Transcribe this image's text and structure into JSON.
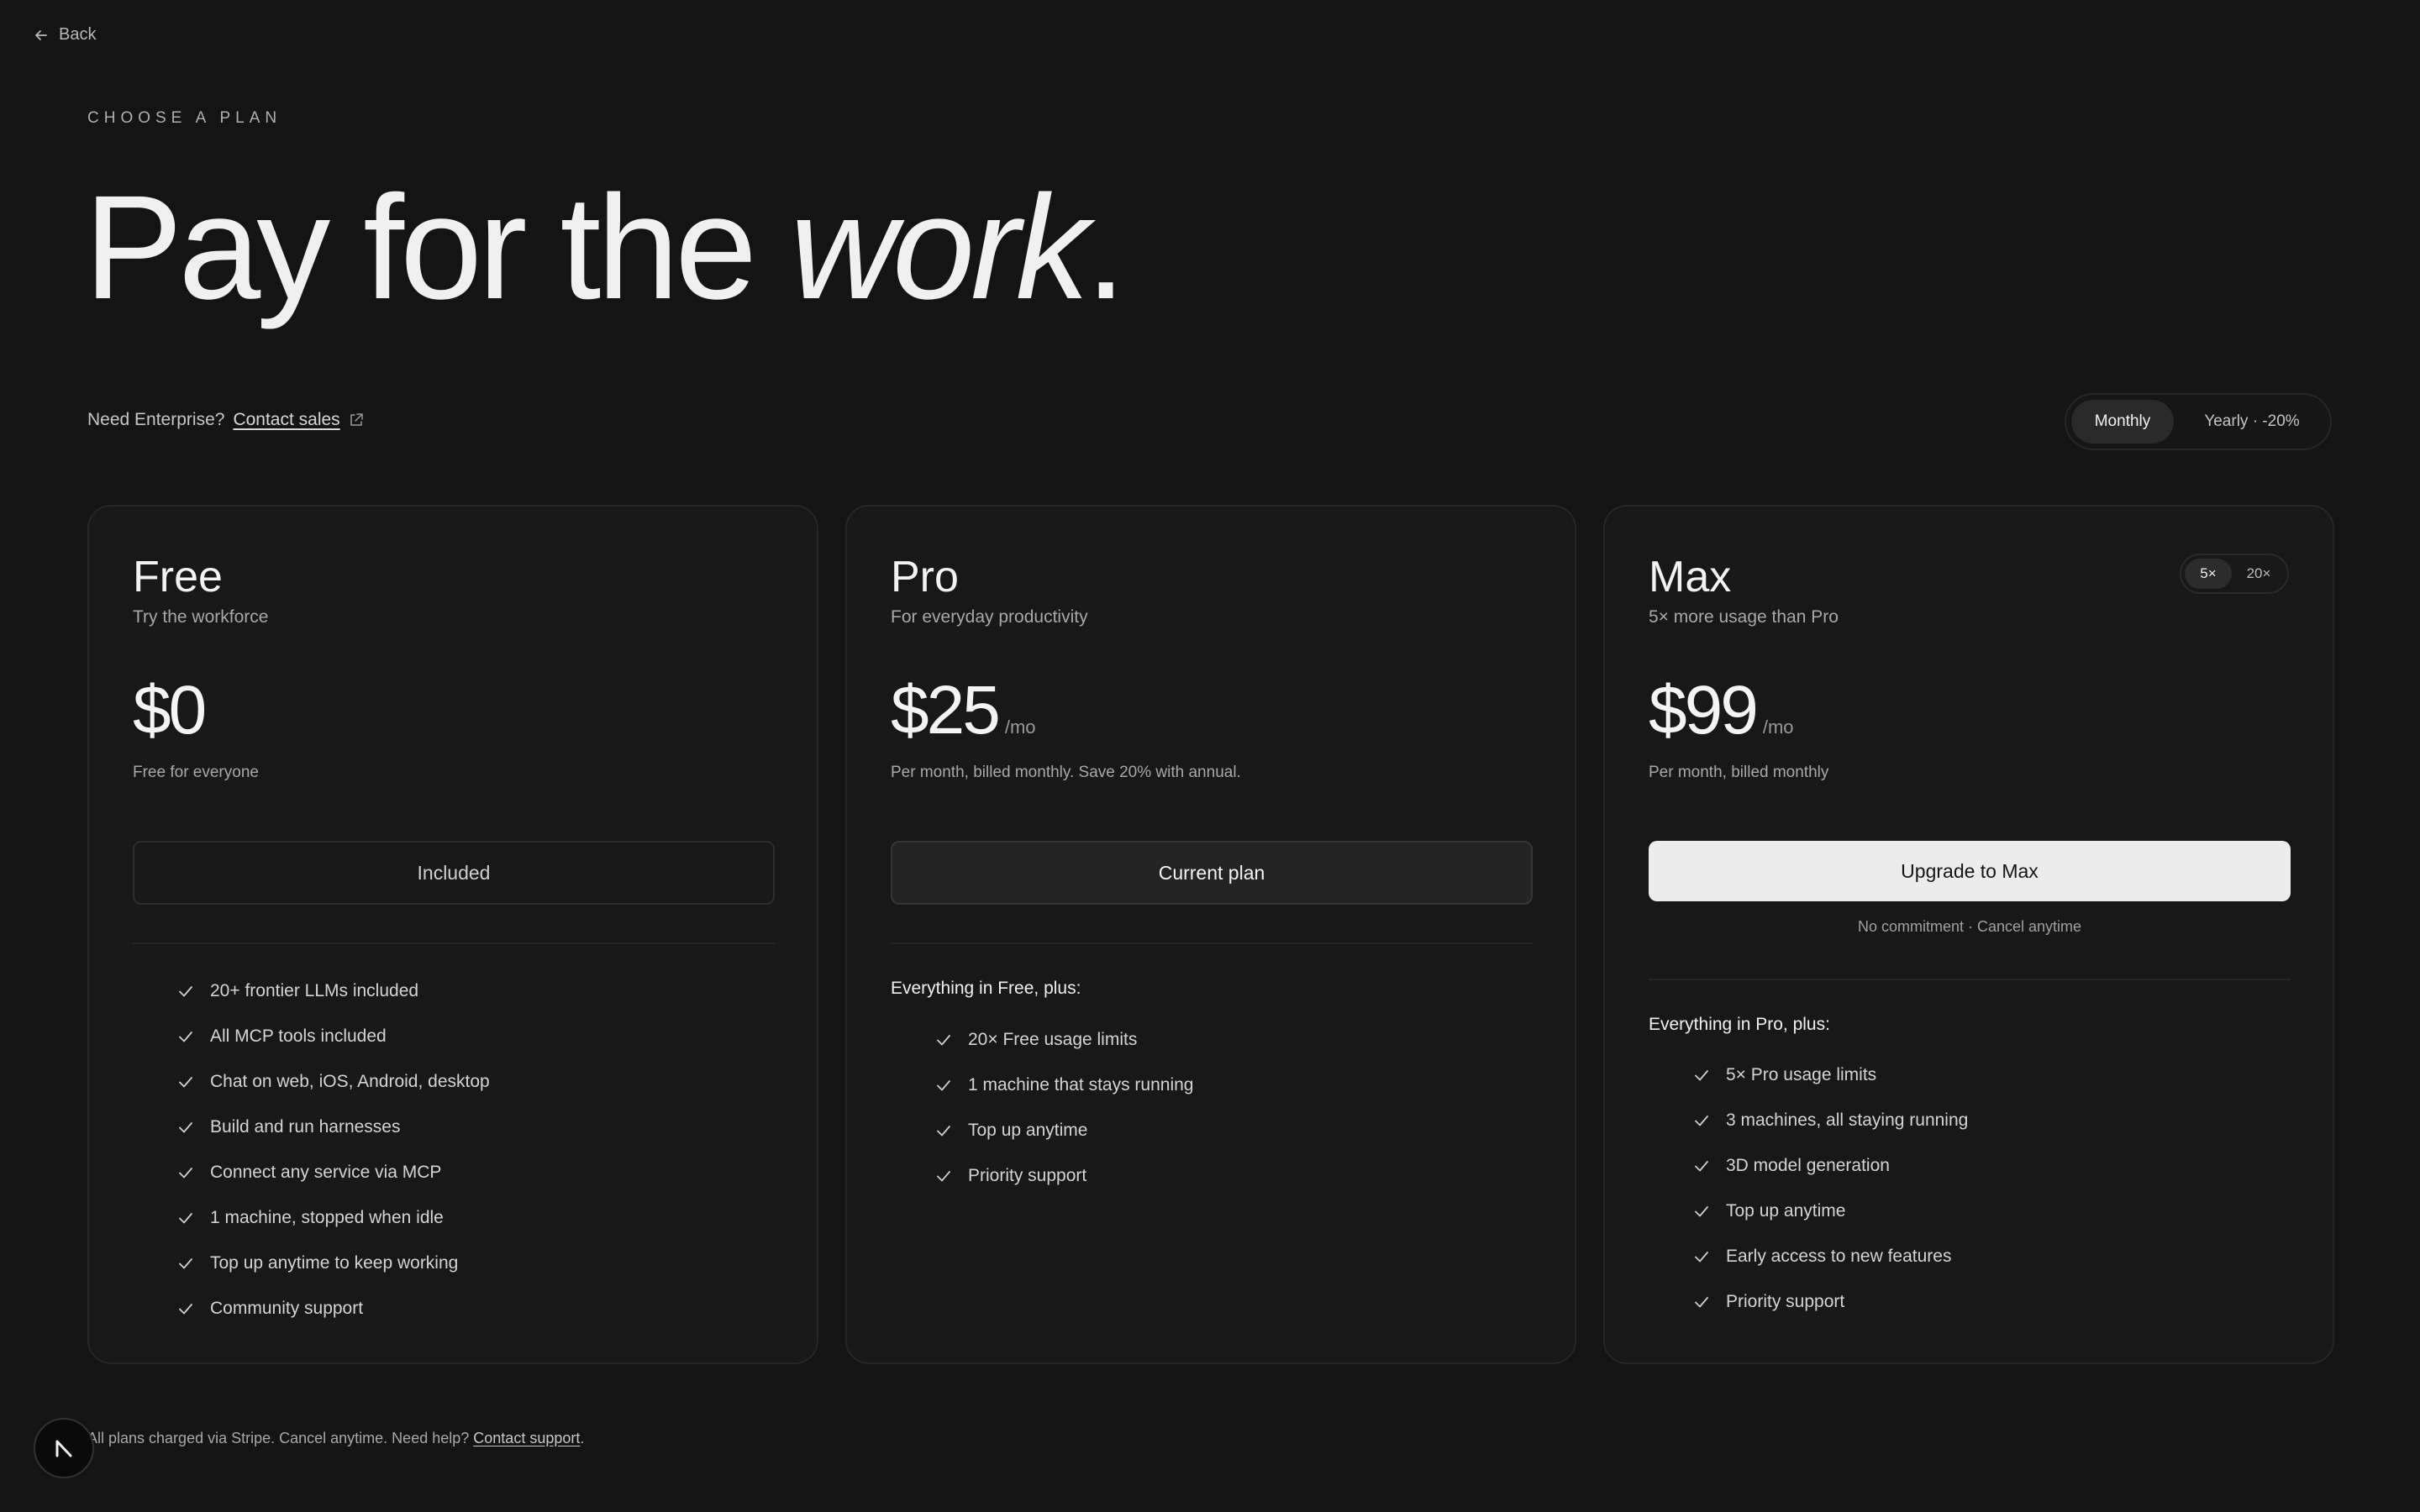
{
  "nav": {
    "back_label": "Back"
  },
  "hero": {
    "eyebrow": "CHOOSE A PLAN",
    "headline_plain": "Pay for the ",
    "headline_italic": "work",
    "headline_end": "."
  },
  "enterprise": {
    "prompt": "Need Enterprise?",
    "link_label": "Contact sales"
  },
  "billing_toggle": {
    "monthly_label": "Monthly",
    "yearly_label": "Yearly · -20%",
    "selected": "Monthly"
  },
  "plans": [
    {
      "name": "Free",
      "tagline": "Try the workforce",
      "price": "$0",
      "period": "",
      "note": "Free for everyone",
      "button_label": "Included",
      "features": [
        "20+ frontier LLMs included",
        "All MCP tools included",
        "Chat on web, iOS, Android, desktop",
        "Build and run harnesses",
        "Connect any service via MCP",
        "1 machine, stopped when idle",
        "Top up anytime to keep working",
        "Community support"
      ]
    },
    {
      "name": "Pro",
      "tagline": "For everyday productivity",
      "price": "$25",
      "period": "/mo",
      "note": "Per month, billed monthly. Save 20% with annual.",
      "button_label": "Current plan",
      "features_lead": "Everything in Free, plus:",
      "features": [
        "20× Free usage limits",
        "1 machine that stays running",
        "Top up anytime",
        "Priority support"
      ]
    },
    {
      "name": "Max",
      "tagline": "5× more usage than Pro",
      "price": "$99",
      "period": "/mo",
      "note": "Per month, billed monthly",
      "button_label": "Upgrade to Max",
      "button_subnote": "No commitment · Cancel anytime",
      "size_options": [
        "5×",
        "20×"
      ],
      "size_selected": "5×",
      "features_lead": "Everything in Pro, plus:",
      "features": [
        "5× Pro usage limits",
        "3 machines, all staying running",
        "3D model generation",
        "Top up anytime",
        "Early access to new features",
        "Priority support"
      ]
    }
  ],
  "footer": {
    "text": "All plans charged via Stripe. Cancel anytime. Need help?",
    "link_label": "Contact support",
    "end": "."
  },
  "icons": {
    "back": "arrow-left-icon",
    "external": "external-link-icon",
    "check": "check-icon",
    "logo": "app-logo-icon"
  }
}
